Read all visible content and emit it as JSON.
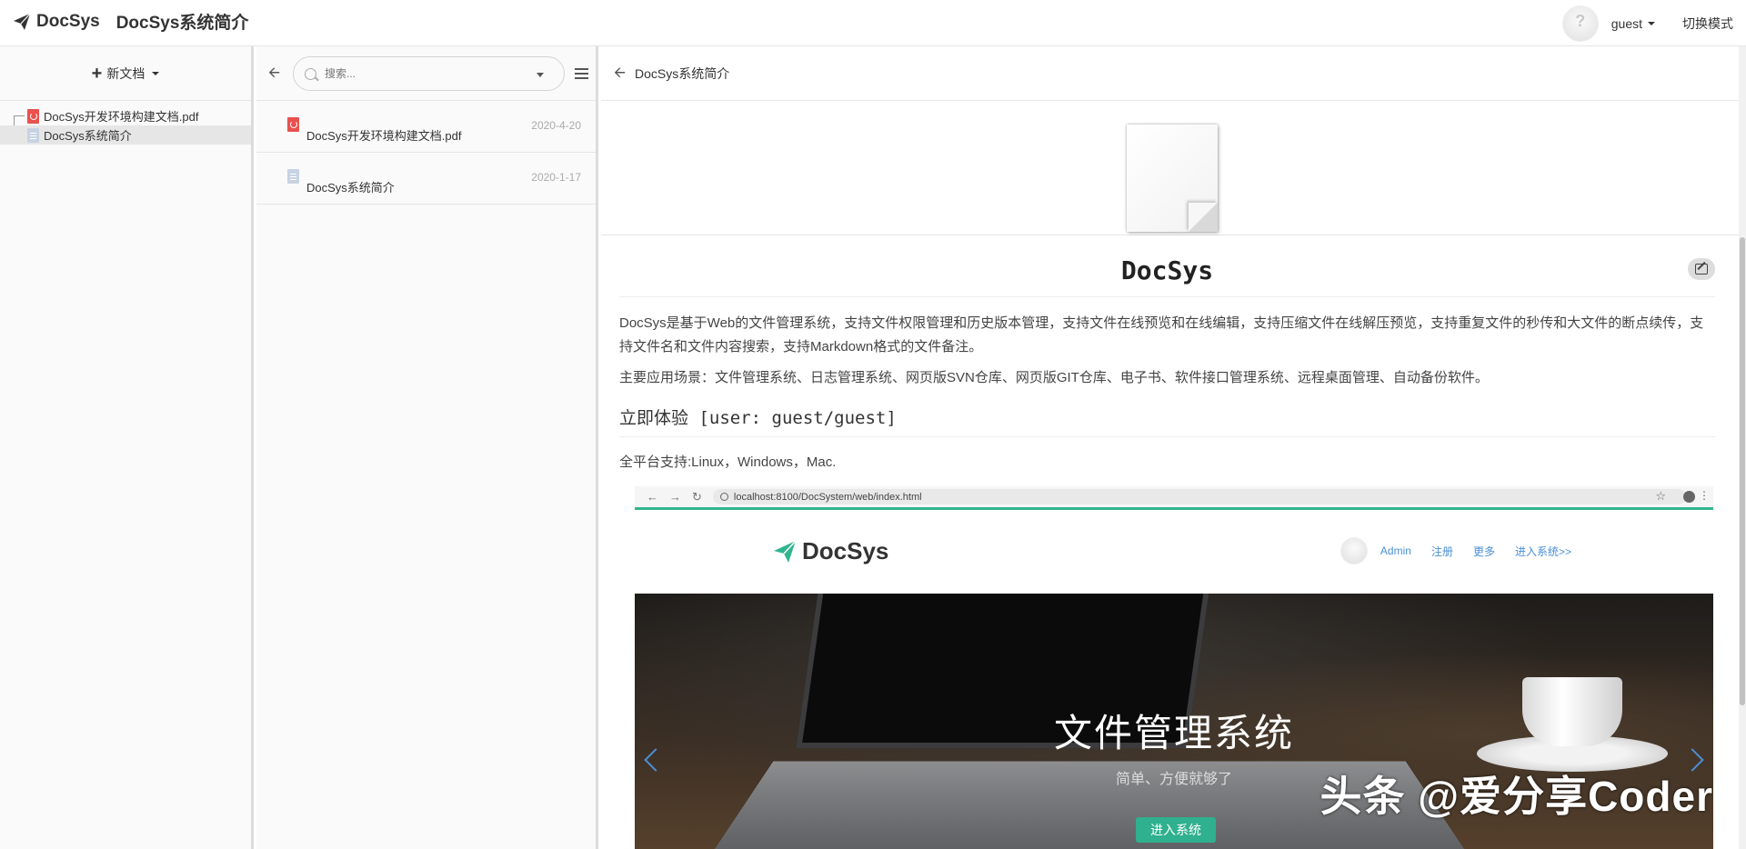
{
  "navbar": {
    "brand": "DocSys",
    "doc_title": "DocSys系统简介",
    "user": "guest",
    "switch_mode": "切换模式"
  },
  "tree": {
    "new_doc_label": "新文档",
    "items": [
      {
        "name": "DocSys开发环境构建文档.pdf",
        "type": "pdf"
      },
      {
        "name": "DocSys系统简介",
        "type": "doc"
      }
    ]
  },
  "list": {
    "search_placeholder": "搜索...",
    "items": [
      {
        "name": "DocSys开发环境构建文档.pdf",
        "date": "2020-4-20",
        "type": "pdf"
      },
      {
        "name": "DocSys系统简介",
        "date": "2020-1-17",
        "type": "doc"
      }
    ]
  },
  "content": {
    "title": "DocSys系统简介",
    "heading": "DocSys",
    "para1": "DocSys是基于Web的文件管理系统，支持文件权限管理和历史版本管理，支持文件在线预览和在线编辑，支持压缩文件在线解压预览，支持重复文件的秒传和大文件的断点续传，支持文件名和文件内容搜索，支持Markdown格式的文件备注。",
    "para2": "主要应用场景：文件管理系统、日志管理系统、网页版SVN仓库、网页版GIT仓库、电子书、软件接口管理系统、远程桌面管理、自动备份软件。",
    "h2": "立即体验 [user: guest/guest]",
    "platform": "全平台支持:Linux，Windows，Mac.",
    "embedded": {
      "url": "localhost:8100/DocSystem/web/index.html",
      "brand": "DocSys",
      "admin": "Admin",
      "register": "注册",
      "more": "更多",
      "enter_link": "进入系统>>",
      "hero_title": "文件管理系统",
      "hero_sub": "简单、方便就够了",
      "hero_btn": "进入系统",
      "watermark": "头条 @爱分享Coder"
    }
  }
}
